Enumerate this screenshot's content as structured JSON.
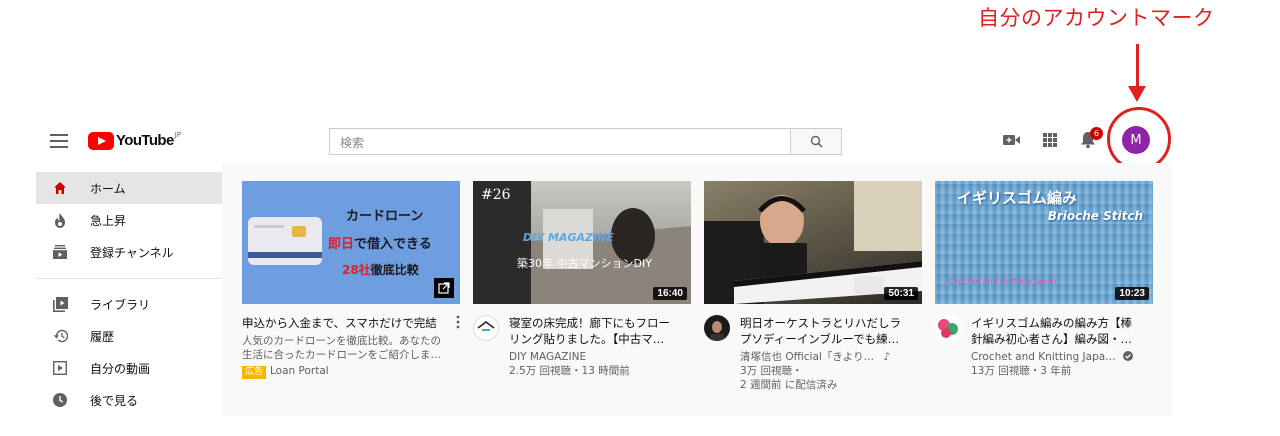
{
  "annotation": {
    "text": "自分のアカウントマーク",
    "color": "#e02020"
  },
  "header": {
    "logo_text": "YouTube",
    "logo_region": "JP",
    "search_placeholder": "検索",
    "notification_count": "6",
    "avatar_initial": "M",
    "avatar_color": "#8e24aa"
  },
  "sidebar": {
    "items": [
      {
        "label": "ホーム",
        "icon": "home-icon",
        "active": true
      },
      {
        "label": "急上昇",
        "icon": "flame-icon"
      },
      {
        "label": "登録チャンネル",
        "icon": "subscriptions-icon"
      },
      {
        "label": "ライブラリ",
        "icon": "library-icon"
      },
      {
        "label": "履歴",
        "icon": "history-icon"
      },
      {
        "label": "自分の動画",
        "icon": "your-videos-icon"
      },
      {
        "label": "後で見る",
        "icon": "watch-later-icon"
      }
    ]
  },
  "videos": [
    {
      "title": "申込から入金まで、スマホだけで完結",
      "thumb_line1": "カードローン",
      "thumb_line2a": "即日",
      "thumb_line2b": "で借入できる",
      "thumb_line3a": "28社",
      "thumb_line3b": "徹底比較",
      "desc_line1": "人気のカードローンを徹底比較。あなたの",
      "desc_line2": "生活に合ったカードローンをご紹介しま…",
      "ad_label": "広告",
      "advertiser": "Loan Portal"
    },
    {
      "title": "寝室の床完成！廊下にもフロー",
      "title2": "リング貼りました。【中古マ…",
      "channel": "DIY MAGAZINE",
      "stats": "2.5万 回視聴・13 時間前",
      "duration": "16:40",
      "thumb_episode": "#26",
      "thumb_brand": "DIY MAGAZINE",
      "thumb_caption": "築30年 中古マンションDIY"
    },
    {
      "title": "明日オーケストラとリハだしラ",
      "title2": "プソディーインブルーでも練…",
      "channel": "清塚信也 Official「きより…",
      "channel_note": "♪",
      "stats": "3万 回視聴・",
      "stats2": "2 週間前 に配信済み",
      "duration": "50:31"
    },
    {
      "title": "イギリスゴム編みの編み方【棒",
      "title2": "針編み初心者さん】編み図・…",
      "channel": "Crochet and Knitting Japa…",
      "stats": "13万 回視聴・3 年前",
      "duration": "10:23",
      "thumb_title": "イギリスゴム編み",
      "thumb_subtitle": "Brioche Stitch",
      "thumb_footer": "Crochet and Knitting Japan"
    }
  ]
}
